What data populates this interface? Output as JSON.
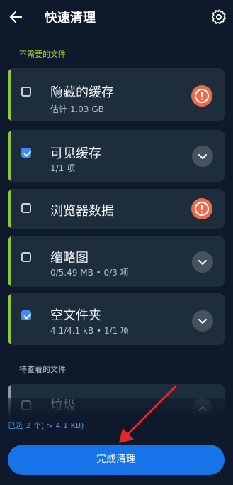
{
  "header": {
    "title": "快速清理",
    "back_icon": "arrow-back-icon",
    "settings_icon": "gear-icon"
  },
  "sections": {
    "unneeded": "不需要的文件",
    "review": "待查看的文件"
  },
  "cards": [
    {
      "title": "隐藏的缓存",
      "subtitle": "估计 1.03 GB",
      "checked": false,
      "icon": "warning-icon"
    },
    {
      "title": "可见缓存",
      "subtitle": "1/1 项",
      "checked": true,
      "icon": "chevron-down-icon"
    },
    {
      "title": "浏览器数据",
      "subtitle": "",
      "checked": false,
      "icon": "warning-icon"
    },
    {
      "title": "缩略图",
      "subtitle": "0/5.49 MB • 0/3 项",
      "checked": false,
      "icon": "chevron-down-icon"
    },
    {
      "title": "空文件夹",
      "subtitle": "4.1/4.1 kB • 1/1 项",
      "checked": true,
      "icon": "chevron-down-icon"
    },
    {
      "title": "垃圾",
      "subtitle": "",
      "checked": false,
      "icon": "chevron-up-icon"
    }
  ],
  "footer": {
    "selected_summary": "已选 2 个( > 4.1 KB)",
    "finish_label": "完成清理"
  },
  "colors": {
    "background": "#0e1a2b",
    "card": "#1d2d3c",
    "accent_green": "#8dc63f",
    "warning": "#ee6a4a",
    "primary_blue": "#1773e8"
  }
}
